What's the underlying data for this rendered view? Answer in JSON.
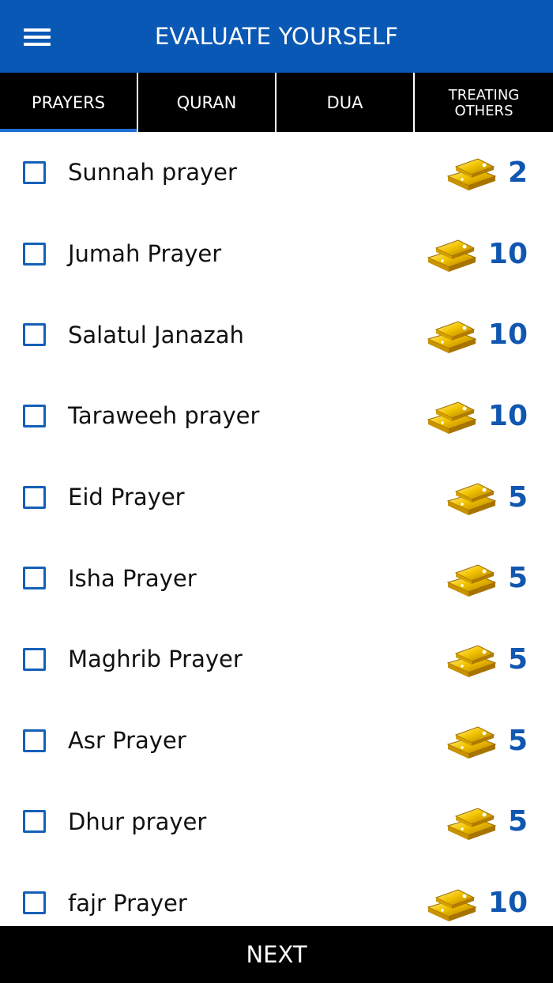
{
  "header": {
    "title": "EVALUATE YOURSELF",
    "menu_icon": "hamburger-menu-icon"
  },
  "tabs": [
    {
      "label": "PRAYERS",
      "active": true
    },
    {
      "label": "QURAN",
      "active": false
    },
    {
      "label": "DUA",
      "active": false
    },
    {
      "label": "TREATING OTHERS",
      "active": false
    }
  ],
  "items": [
    {
      "label": "Sunnah prayer",
      "points": "2",
      "checked": false
    },
    {
      "label": "Jumah Prayer",
      "points": "10",
      "checked": false
    },
    {
      "label": "Salatul Janazah",
      "points": "10",
      "checked": false
    },
    {
      "label": "Taraweeh prayer",
      "points": "10",
      "checked": false
    },
    {
      "label": "Eid Prayer",
      "points": "5",
      "checked": false
    },
    {
      "label": "Isha Prayer",
      "points": "5",
      "checked": false
    },
    {
      "label": "Maghrib Prayer",
      "points": "5",
      "checked": false
    },
    {
      "label": "Asr Prayer",
      "points": "5",
      "checked": false
    },
    {
      "label": "Dhur prayer",
      "points": "5",
      "checked": false
    },
    {
      "label": "fajr Prayer",
      "points": "10",
      "checked": false
    }
  ],
  "footer": {
    "next_label": "NEXT"
  },
  "colors": {
    "header_bg": "#0a58b5",
    "tab_bg": "#000000",
    "tab_indicator": "#1e6fd1",
    "checkbox_border": "#1460b8",
    "points_text": "#1157b0",
    "gold": "#e8b800"
  }
}
